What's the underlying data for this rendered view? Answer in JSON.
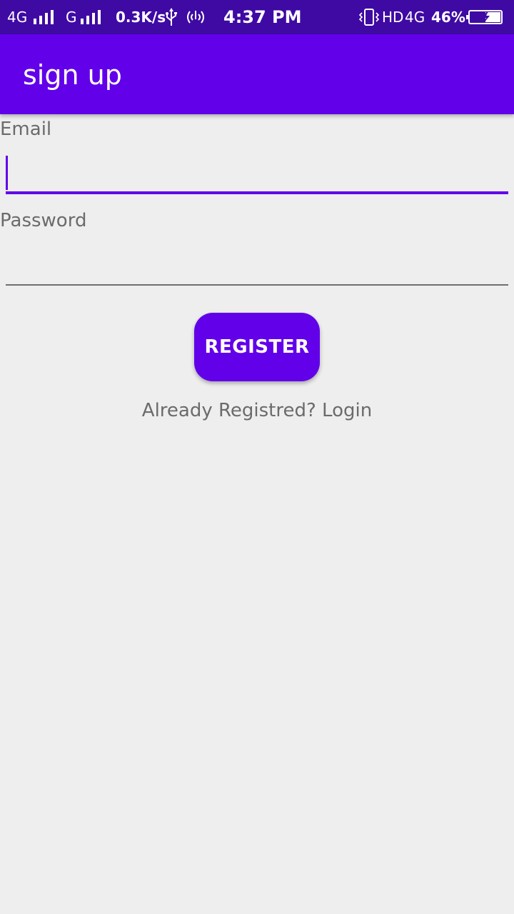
{
  "status_bar": {
    "network_1": "4G",
    "network_2": "G",
    "data_speed": "0.3K/s",
    "time": "4:37 PM",
    "hd": "HD",
    "network_3": "4G",
    "battery_percent": "46%",
    "background_color": "#3f0aa3"
  },
  "app_bar": {
    "title": "sign up",
    "background_color": "#6200ea"
  },
  "form": {
    "email": {
      "label": "Email",
      "value": "",
      "placeholder": ""
    },
    "password": {
      "label": "Password",
      "value": "",
      "placeholder": ""
    },
    "register_label": "REGISTER",
    "login_link": "Already Registred? Login"
  },
  "icons": {
    "signal": "signal-icon",
    "usb": "usb-icon",
    "hotspot": "hotspot-icon",
    "vibrate": "vibrate-icon",
    "battery": "battery-charging-icon"
  },
  "colors": {
    "accent": "#6200ea",
    "background": "#eeeeee",
    "text_secondary": "#6b6b6b"
  }
}
